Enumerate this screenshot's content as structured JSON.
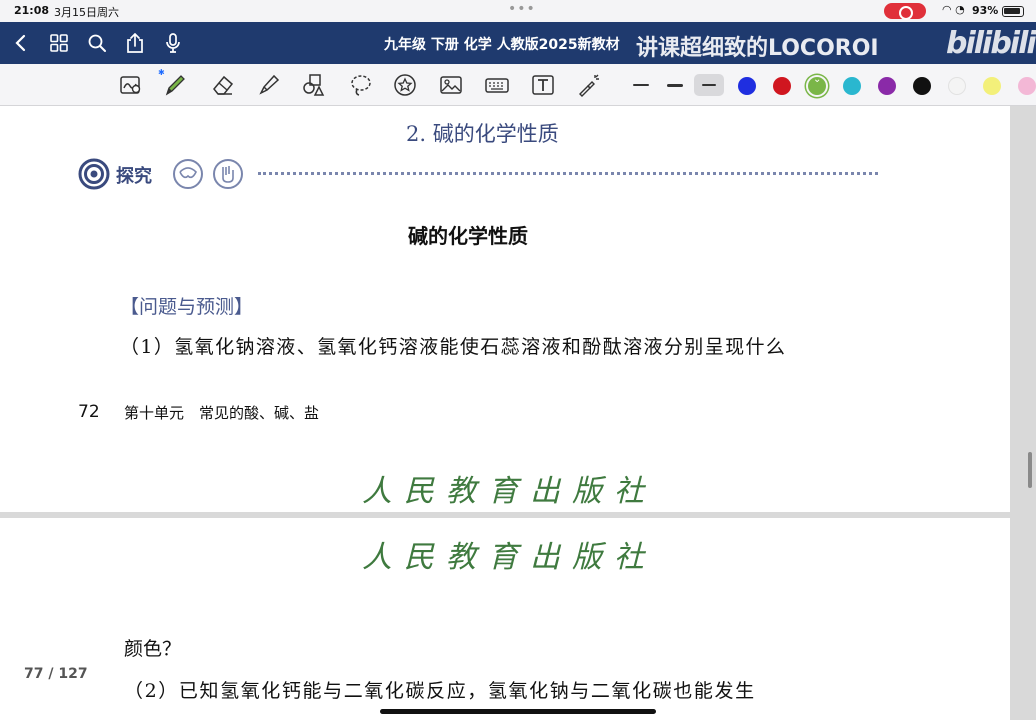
{
  "status_bar": {
    "time": "21:08",
    "date": "3月15日周六",
    "battery": "93%"
  },
  "nav_bar": {
    "title": "九年级 下册 化学 人教版2025新教材",
    "overlay_caption": "讲课超细致的LOCOROI",
    "watermark": "bilibili",
    "icons": [
      "back-icon",
      "grid-icon",
      "search-icon",
      "share-icon",
      "mic-icon",
      "bookmark-icon",
      "add-page-icon",
      "more-icon"
    ]
  },
  "toolbar": {
    "tools": [
      "lasso-zoom-icon",
      "pen-icon",
      "eraser-icon",
      "highlighter-icon",
      "shapes-icon",
      "lasso-icon",
      "sticker-icon",
      "image-icon",
      "keyboard-icon",
      "textbox-icon",
      "laser-icon"
    ],
    "stroke_widths": [
      "thin",
      "medium",
      "thick"
    ],
    "selected_stroke": "thick",
    "colors": [
      "#1f2ee0",
      "#d0161f",
      "#7ab648",
      "#2ab7cf",
      "#8a2aa8",
      "#111111",
      "#f4f4f4",
      "#f3f07a",
      "#f3b8d6"
    ],
    "selected_color": "#7ab648"
  },
  "page1": {
    "section_title": "2. 碱的化学性质",
    "explore_label": "探究",
    "heading": "碱的化学性质",
    "subheading": "【问题与预测】",
    "paragraph1": "（1）氢氧化钠溶液、氢氧化钙溶液能使石蕊溶液和酚酞溶液分别呈现什么",
    "footer_page": "72",
    "footer_text": "第十单元　常见的酸、碱、盐",
    "publisher": "人民教育出版社"
  },
  "page2": {
    "publisher": "人民教育出版社",
    "paragraph_cont": "颜色？",
    "paragraph2": "（2）已知氢氧化钙能与二氧化碳反应，氢氧化钠与二氧化碳也能发生"
  },
  "page_indicator": "77 / 127"
}
